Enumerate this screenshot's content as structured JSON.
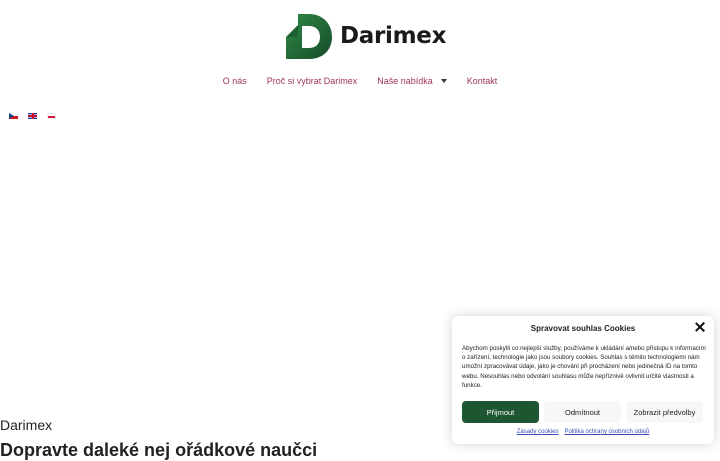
{
  "header": {
    "brand": "Darimex"
  },
  "nav": {
    "items": [
      {
        "label": "O nás"
      },
      {
        "label": "Proč si vybrat Darimex"
      },
      {
        "label": "Naše nabídka"
      },
      {
        "label": "Kontakt"
      }
    ]
  },
  "languages": [
    "cz-flag",
    "gb-flag",
    "pl-flag"
  ],
  "page": {
    "heading": "Darimex",
    "subheading": "Dopravte daleké nej ořádkové naučci"
  },
  "cookie": {
    "title": "Spravovat souhlas Cookies",
    "body": "Abychom poskytli co nejlepší služby, používáme k ukládání a/nebo přístupu k informacím o zařízení, technologie jako jsou soubory cookies. Souhlas s těmito technologiemi nám umožní zpracovávat údaje, jako je chování při procházení nebo jedinečná ID na tomto webu. Nesouhlas nebo odvolání souhlasu může nepříznivě ovlivnit určité vlastnosti a funkce.",
    "accept_label": "Přijmout",
    "deny_label": "Odmítnout",
    "prefs_label": "Zobrazit předvolby",
    "link_cookies": "Zásady cookies",
    "link_privacy": "Politika ochrany osobních údajů"
  },
  "colors": {
    "brand_green": "#1e5631",
    "nav_text": "#a0345e",
    "link_blue": "#3a4fb5"
  }
}
